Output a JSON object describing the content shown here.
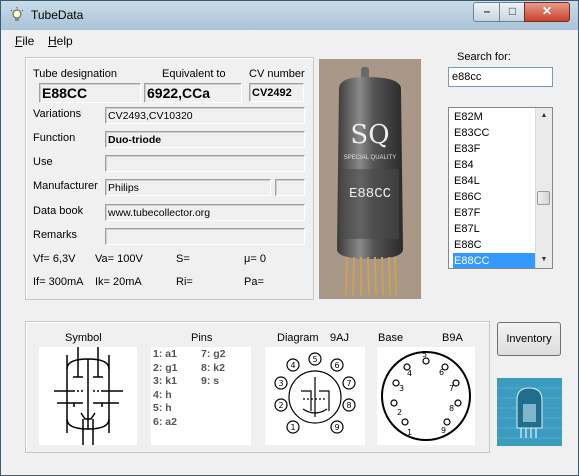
{
  "window": {
    "title": "TubeData"
  },
  "menu": {
    "file_prefix": "",
    "file_u": "F",
    "file_rest": "ile",
    "help_u": "H",
    "help_rest": "elp"
  },
  "tube": {
    "designation_label": "Tube designation",
    "designation": "E88CC",
    "equivalent_label": "Equivalent to",
    "equivalent": "6922,CCa",
    "cv_label": "CV number",
    "cv": "CV2492",
    "variations_label": "Variations",
    "variations": "CV2493,CV10320",
    "function_label": "Function",
    "function": "Duo-triode",
    "use_label": "Use",
    "use": "",
    "manufacturer_label": "Manufacturer",
    "manufacturer": "Philips",
    "databook_label": "Data book",
    "databook": "www.tubecollector.org",
    "remarks_label": "Remarks",
    "remarks": ""
  },
  "ratings": {
    "vf": "Vf= 6,3V",
    "va": "Va= 100V",
    "s": "S=",
    "mu": "μ=   0",
    "if": "If= 300mA",
    "ik": "Ik=   20mA",
    "ri": "Ri=",
    "pa": "Pa="
  },
  "search": {
    "label": "Search for:",
    "value": "e88cc",
    "list": [
      "E82M",
      "E83CC",
      "E83F",
      "E84",
      "E84L",
      "E86C",
      "E87F",
      "E87L",
      "E88C",
      "E88CC"
    ],
    "selected": "E88CC"
  },
  "lower": {
    "symbol_label": "Symbol",
    "pins_label": "Pins",
    "diagram_label": "Diagram",
    "diagram_code": "9AJ",
    "base_label": "Base",
    "base_code": "B9A",
    "pins_left": [
      "1: a1",
      "2: g1",
      "3: k1",
      "4: h",
      "5: h",
      "6: a2"
    ],
    "pins_right": [
      "7: g2",
      "8: k2",
      "9: s"
    ]
  },
  "photo": {
    "brand": "SQ",
    "brand_sub": "SPECIAL QUALITY",
    "type_marking": "E88CC"
  },
  "buttons": {
    "inventory": "Inventory"
  },
  "colors": {
    "selection": "#3399ff",
    "titlebar": "#b4cde0",
    "close": "#c8432b"
  }
}
